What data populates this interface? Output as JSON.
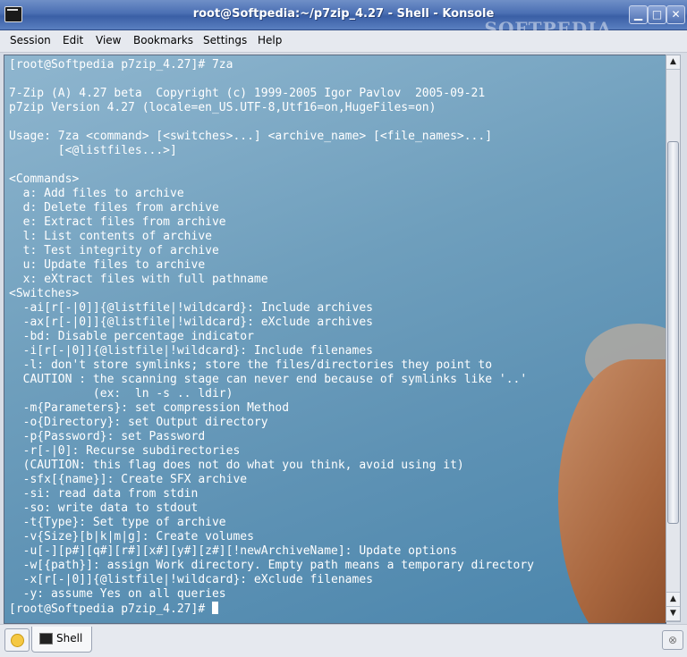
{
  "window": {
    "title": "root@Softpedia:~/p7zip_4.27 - Shell - Konsole",
    "watermark": "SOFTPEDIA",
    "minimize_icon": "minimize-icon",
    "maximize_icon": "maximize-icon",
    "close_icon": "close-icon",
    "minimize_glyph": "▁",
    "maximize_glyph": "□",
    "close_glyph": "✕"
  },
  "menu": {
    "session": "Session",
    "edit": "Edit",
    "view": "View",
    "bookmarks": "Bookmarks",
    "settings": "Settings",
    "help": "Help"
  },
  "terminal": {
    "output": "[root@Softpedia p7zip_4.27]# 7za\n\n7-Zip (A) 4.27 beta  Copyright (c) 1999-2005 Igor Pavlov  2005-09-21\np7zip Version 4.27 (locale=en_US.UTF-8,Utf16=on,HugeFiles=on)\n\nUsage: 7za <command> [<switches>...] <archive_name> [<file_names>...]\n       [<@listfiles...>]\n\n<Commands>\n  a: Add files to archive\n  d: Delete files from archive\n  e: Extract files from archive\n  l: List contents of archive\n  t: Test integrity of archive\n  u: Update files to archive\n  x: eXtract files with full pathname\n<Switches>\n  -ai[r[-|0]]{@listfile|!wildcard}: Include archives\n  -ax[r[-|0]]{@listfile|!wildcard}: eXclude archives\n  -bd: Disable percentage indicator\n  -i[r[-|0]]{@listfile|!wildcard}: Include filenames\n  -l: don't store symlinks; store the files/directories they point to\n  CAUTION : the scanning stage can never end because of symlinks like '..'\n            (ex:  ln -s .. ldir)\n  -m{Parameters}: set compression Method\n  -o{Directory}: set Output directory\n  -p{Password}: set Password\n  -r[-|0]: Recurse subdirectories\n  (CAUTION: this flag does not do what you think, avoid using it)\n  -sfx[{name}]: Create SFX archive\n  -si: read data from stdin\n  -so: write data to stdout\n  -t{Type}: Set type of archive\n  -v{Size}[b|k|m|g]: Create volumes\n  -u[-][p#][q#][r#][x#][y#][z#][!newArchiveName]: Update options\n  -w[{path}]: assign Work directory. Empty path means a temporary directory\n  -x[r[-|0]]{@listfile|!wildcard}: eXclude filenames\n  -y: assume Yes on all queries",
    "prompt": "[root@Softpedia p7zip_4.27]# "
  },
  "scrollbar": {
    "up_arrow": "▲",
    "down_arrow": "▼"
  },
  "tabs": {
    "new_session_icon": "new-session-icon",
    "items": [
      {
        "label": "Shell"
      }
    ],
    "close_session_glyph": "⊗"
  }
}
